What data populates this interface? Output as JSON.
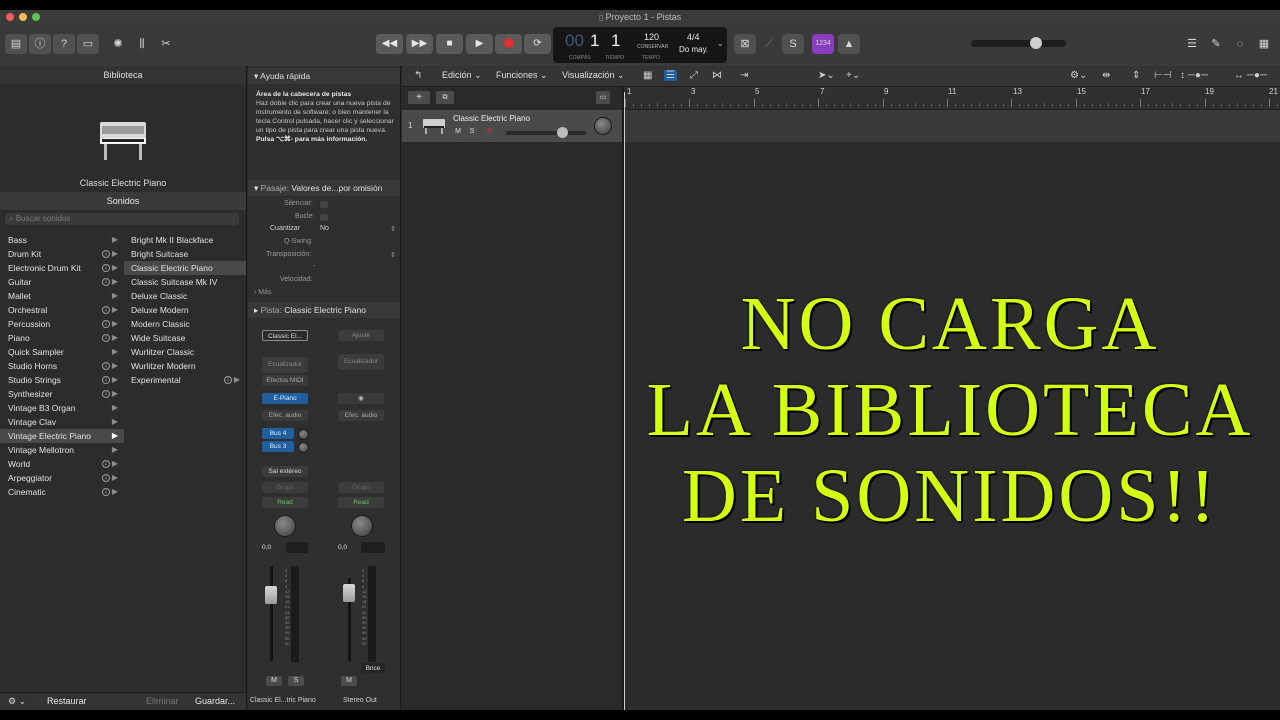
{
  "window": {
    "title": "Proyecto 1 - Pistas"
  },
  "transport": {
    "lcd_bar": "1",
    "lcd_beat": "1",
    "lcd_bar_label": "COMPÁS",
    "lcd_beat_label": "TIEMPO",
    "lcd_prefix": "00",
    "tempo": "120",
    "tempo_label": "CONSERVAR",
    "tempo_sub": "TEMPO",
    "signature": "4/4",
    "key": "Do may.",
    "counter_badge": "1234"
  },
  "library": {
    "header": "Biblioteca",
    "instrument": "Classic Electric Piano",
    "sounds_header": "Sonidos",
    "search_placeholder": "Buscar sonidos",
    "categories": [
      {
        "label": "Bass"
      },
      {
        "label": "Drum Kit"
      },
      {
        "label": "Electronic Drum Kit"
      },
      {
        "label": "Guitar"
      },
      {
        "label": "Mallet"
      },
      {
        "label": "Orchestral"
      },
      {
        "label": "Percussion"
      },
      {
        "label": "Piano"
      },
      {
        "label": "Quick Sampler"
      },
      {
        "label": "Studio Horns"
      },
      {
        "label": "Studio Strings"
      },
      {
        "label": "Synthesizer"
      },
      {
        "label": "Vintage B3 Organ"
      },
      {
        "label": "Vintage Clav"
      },
      {
        "label": "Vintage Electric Piano"
      },
      {
        "label": "Vintage Mellotron"
      },
      {
        "label": "World"
      },
      {
        "label": "Arpeggiator"
      },
      {
        "label": "Cinematic"
      }
    ],
    "patches": [
      {
        "label": "Bright Mk II Blackface"
      },
      {
        "label": "Bright Suitcase"
      },
      {
        "label": "Classic Electric Piano"
      },
      {
        "label": "Classic Suitcase Mk IV"
      },
      {
        "label": "Deluxe Classic"
      },
      {
        "label": "Deluxe Modern"
      },
      {
        "label": "Modern Classic"
      },
      {
        "label": "Wide Suitcase"
      },
      {
        "label": "Wurlitzer Classic"
      },
      {
        "label": "Wurlitzer Modern"
      },
      {
        "label": "Experimental"
      }
    ],
    "restore_label": "Restaurar",
    "delete_label": "Eliminar",
    "save_label": "Guardar..."
  },
  "inspector": {
    "quick_help_header": "Ayuda rápida",
    "quick_help_title": "Área de la cabecera de pistas",
    "quick_help_body": "Haz doble clic para crear una nueva pista de instrumento de software; o bien mantener la tecla Control pulsada, hacer clic y seleccionar un tipo de pista para crear una pista nueva.",
    "quick_help_more": "Pulsa ⌥⌘- para más información.",
    "region_header": "Pasaje:",
    "region_value": "Valores de...por omisión",
    "mute_label": "Silenciar:",
    "loop_label": "Bucle:",
    "quantize_label": "Cuantizar",
    "quantize_value": "No",
    "qswing_label": "Q-Swing:",
    "transpose_label": "Transposición:",
    "transpose_value": "-",
    "velocity_label": "Velocidad:",
    "more_label": "Más",
    "track_header": "Pista:",
    "track_value": "Classic Electric Piano",
    "ch1": {
      "setting": "Classic El...",
      "eq": "Ecualizador",
      "midi_fx": "Efectos MIDI",
      "instrument": "E-Piano",
      "audio_fx": "Efec. audio",
      "send1": "Bus 4",
      "send2": "Bus 3",
      "output": "Sal estéreo",
      "group": "Grupo",
      "automation": "Read",
      "pan_value": "0,0",
      "mute": "M",
      "solo": "S",
      "name": "Classic El...tric Piano"
    },
    "ch2": {
      "setting": "Ajuste",
      "eq": "Ecualizador",
      "audio_fx": "Efec. audio",
      "group": "Grupo",
      "automation": "Read",
      "pan_value": "0,0",
      "mute": "M",
      "bounce": "Bnce",
      "name": "Stereo Out"
    },
    "meter_scale": [
      "0",
      "3",
      "6",
      "9",
      "12",
      "15",
      "18",
      "21",
      "24",
      "30",
      "35",
      "40",
      "45",
      "50",
      "60"
    ]
  },
  "tracks": {
    "menu": {
      "edit": "Edición",
      "functions": "Funciones",
      "view": "Visualización"
    },
    "track1": {
      "number": "1",
      "name": "Classic Electric Piano",
      "mute": "M",
      "solo": "S",
      "record": "R"
    },
    "ruler": [
      "1",
      "3",
      "5",
      "7",
      "9",
      "11",
      "13",
      "15",
      "17",
      "19",
      "21"
    ]
  },
  "overlay": {
    "line1": "NO CARGA",
    "line2": "LA BIBLIOTECA",
    "line3": "DE SONIDOS!!"
  },
  "colors": {
    "overlay_text": "#d4ff10",
    "accent_blue": "#1f5fa0",
    "record_red": "#e03030",
    "read_green": "#5fc45f"
  }
}
